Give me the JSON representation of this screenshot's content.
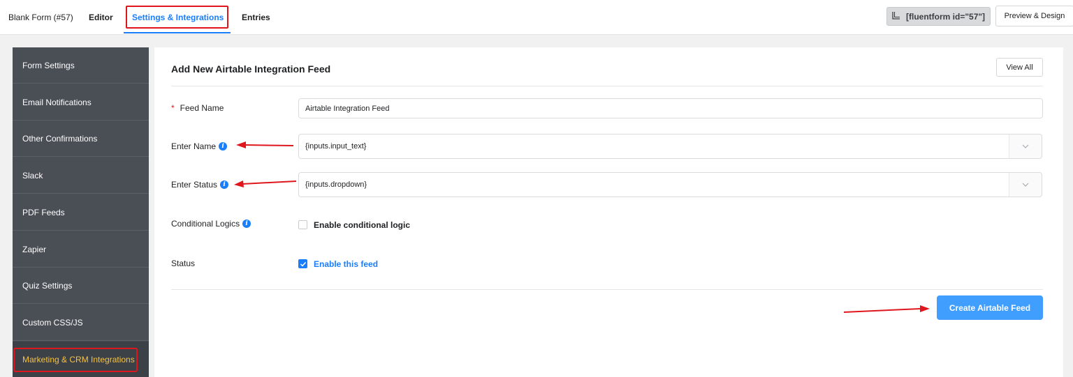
{
  "header": {
    "form_title": "Blank Form (#57)",
    "nav": [
      "Editor",
      "Settings & Integrations",
      "Entries"
    ],
    "shortcode": "[fluentform id=\"57\"]",
    "preview_label": "Preview & Design"
  },
  "sidebar": {
    "items": [
      {
        "label": "Form Settings"
      },
      {
        "label": "Email Notifications"
      },
      {
        "label": "Other Confirmations"
      },
      {
        "label": "Slack"
      },
      {
        "label": "PDF Feeds"
      },
      {
        "label": "Zapier"
      },
      {
        "label": "Quiz Settings"
      },
      {
        "label": "Custom CSS/JS"
      },
      {
        "label": "Marketing & CRM Integrations",
        "active": true
      }
    ]
  },
  "main": {
    "title": "Add New Airtable Integration Feed",
    "view_all_label": "View All",
    "feed_name": {
      "label": "Feed Name",
      "required_mark": "*",
      "value": "Airtable Integration Feed"
    },
    "enter_name": {
      "label": "Enter Name",
      "value": "{inputs.input_text}"
    },
    "enter_status": {
      "label": "Enter Status",
      "value": "{inputs.dropdown}"
    },
    "conditional_logics": {
      "label": "Conditional Logics",
      "checkbox_label": "Enable conditional logic",
      "checked": false
    },
    "status": {
      "label": "Status",
      "checkbox_label": "Enable this feed",
      "checked": true
    },
    "submit_label": "Create Airtable Feed"
  },
  "colors": {
    "primary": "#1a7efb",
    "button": "#409eff",
    "sidebar_bg": "#4a4e55",
    "active_text": "#f5c242",
    "annotation_red": "#e0161d"
  },
  "icons": [
    "shortcode-icon",
    "info-icon",
    "chevron-down-icon",
    "checkmark-icon",
    "annotation-arrow"
  ]
}
